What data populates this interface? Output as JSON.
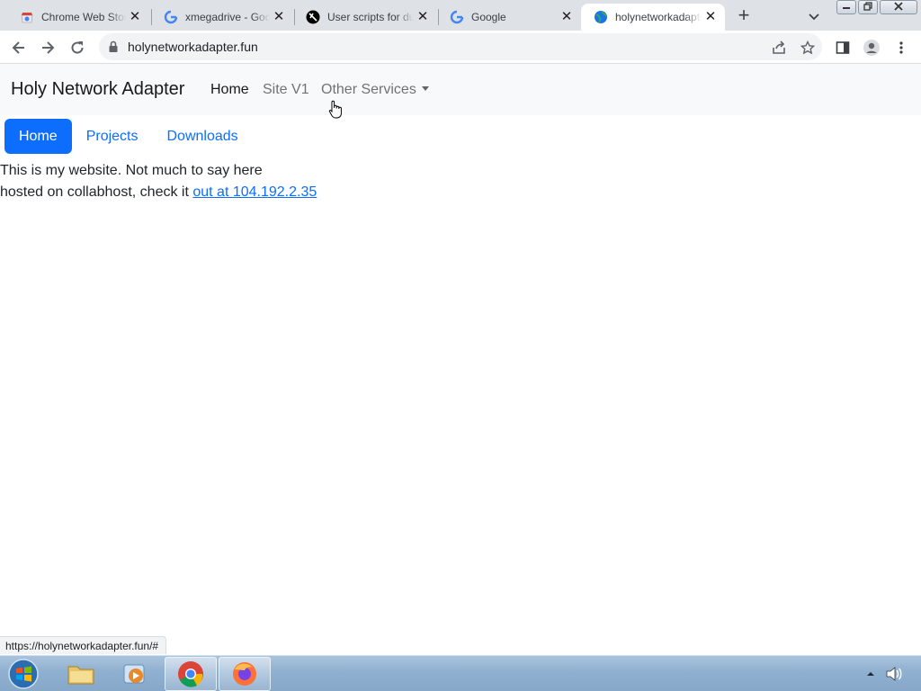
{
  "browser": {
    "tabs": [
      {
        "title": "Chrome Web Store",
        "favicon": "chrome-web-store-icon",
        "active": false
      },
      {
        "title": "xmegadrive - Google Search",
        "favicon": "google-g-icon",
        "active": false
      },
      {
        "title": "User scripts for dummies",
        "favicon": "userscripts-icon",
        "active": false
      },
      {
        "title": "Google",
        "favicon": "google-g-icon",
        "active": false
      },
      {
        "title": "holynetworkadapter.fun",
        "favicon": "globe-icon",
        "active": true
      }
    ],
    "close_glyph": "✕",
    "new_tab_glyph": "+",
    "url": "holynetworkadapter.fun",
    "status_url": "https://holynetworkadapter.fun/#"
  },
  "site": {
    "brand": "Holy Network Adapter",
    "nav": {
      "home": "Home",
      "site_v1": "Site V1",
      "other_services": "Other Services"
    },
    "pills": [
      {
        "label": "Home",
        "active": true
      },
      {
        "label": "Projects",
        "active": false
      },
      {
        "label": "Downloads",
        "active": false
      }
    ],
    "body": {
      "line1": "This is my website. Not much to say here",
      "line2_prefix": "hosted on collabhost, check it ",
      "line2_link": "out at 104.192.2.35"
    }
  },
  "colors": {
    "primary": "#0d6efd",
    "navbar_bg": "#f8f9fa",
    "tabstrip_bg": "#dee1e6"
  }
}
